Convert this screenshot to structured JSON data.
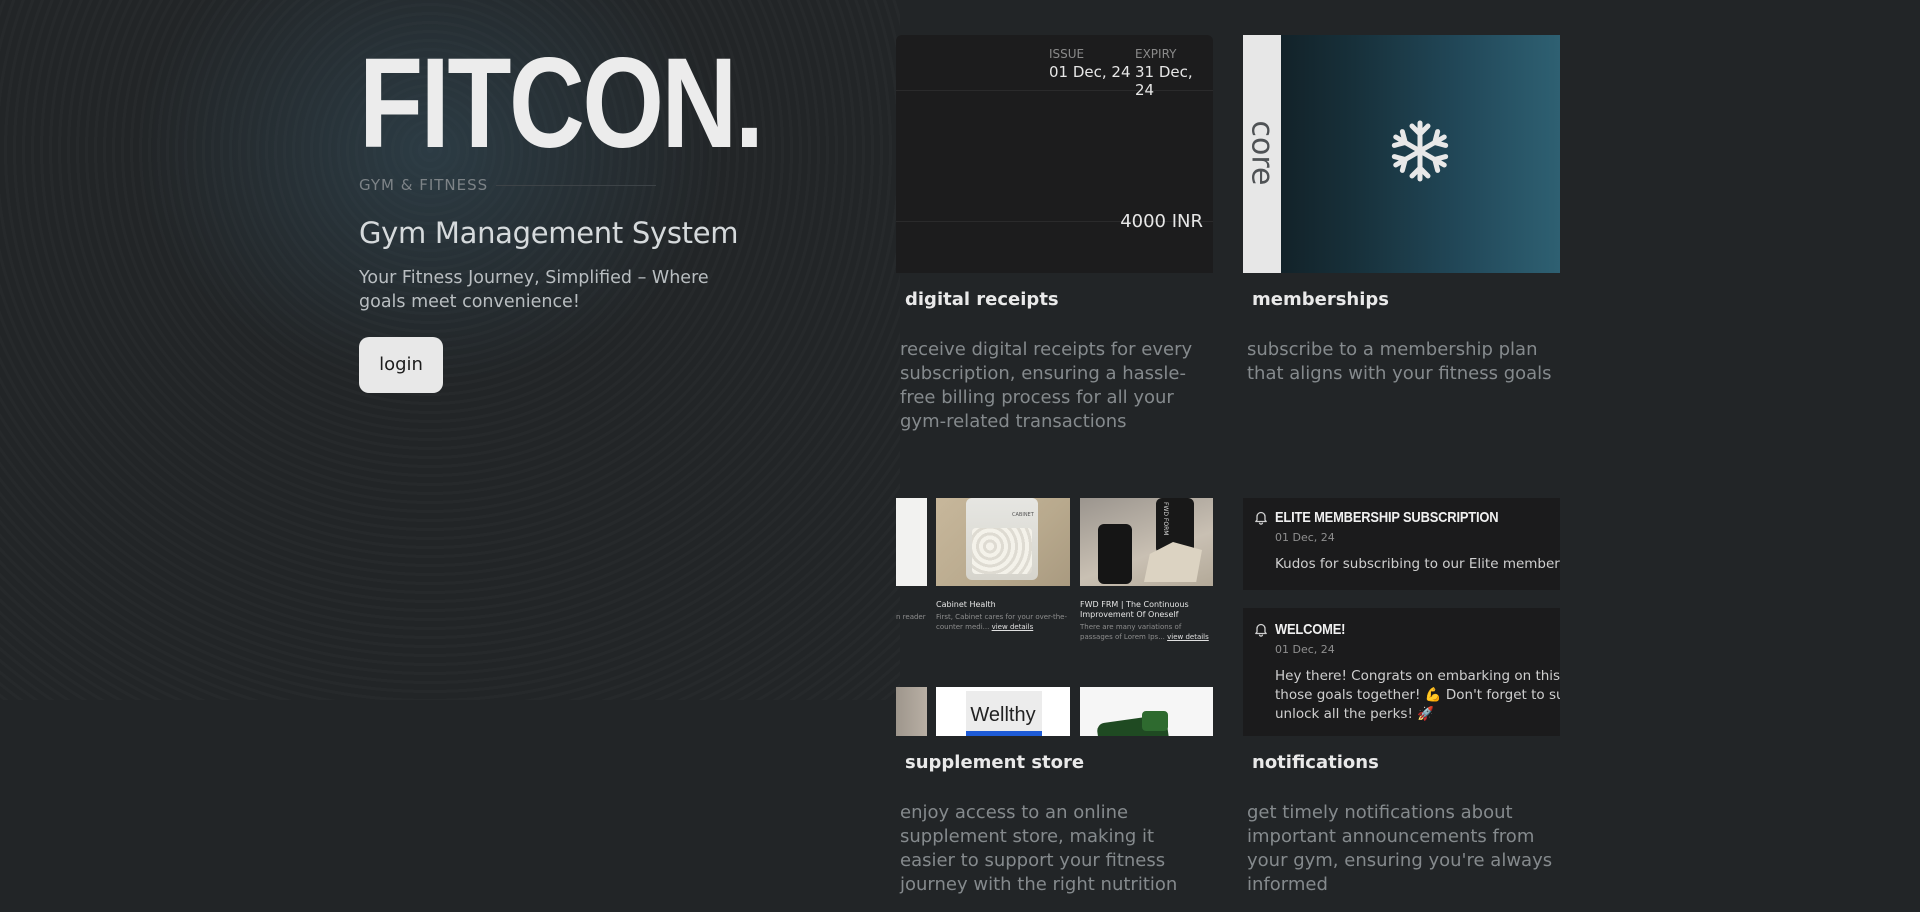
{
  "hero": {
    "logo": "FITCON.",
    "tagline": "GYM & FITNESS",
    "title": "Gym Management System",
    "subtitle": "Your Fitness Journey, Simplified – Where goals meet convenience!",
    "login_label": "login"
  },
  "features": {
    "receipts": {
      "title": "digital receipts",
      "description": "receive digital receipts for every subscription, ensuring a hassle-free billing process for all your gym-related transactions",
      "issue_label": "ISSUE",
      "issue_date": "01 Dec, 24",
      "expiry_label": "EXPIRY",
      "expiry_date": "31 Dec, 24",
      "amount": "4000 INR"
    },
    "memberships": {
      "title": "memberships",
      "description": "subscribe to a membership plan that aligns with your fitness goals",
      "plan_label": "core",
      "icon": "snowflake-icon"
    },
    "store": {
      "title": "supplement store",
      "description": "enjoy access to an online supplement store, making it easier to support your fitness journey with the right nutrition",
      "partial_text": "n reader",
      "products": [
        {
          "name": "Cabinet Health",
          "text": "First, Cabinet cares for your over-the-counter medi...",
          "link": "view details",
          "jar_label": "CABINET"
        },
        {
          "name": "FWD FRM | The Continuous Improvement Of Oneself",
          "text": "There are many variations of passages of Lorem Ips...",
          "link": "view details",
          "jar_label": "FWD FORM"
        }
      ],
      "bottom_row": [
        {
          "label": ""
        },
        {
          "label": "Wellthy"
        },
        {
          "label": ""
        }
      ]
    },
    "notifications": {
      "title": "notifications",
      "description": "get timely notifications about important announcements from your gym, ensuring you're always informed",
      "items": [
        {
          "title": "ELITE MEMBERSHIP SUBSCRIPTION",
          "date": "01 Dec, 24",
          "body": [
            "Kudos for subscribing to our Elite membership!"
          ]
        },
        {
          "title": "WELCOME!",
          "date": "01 Dec, 24",
          "body": [
            "Hey there! Congrats on embarking on this fitne",
            "those goals together! 💪 Don't forget to subsc",
            "unlock all the perks! 🚀"
          ]
        }
      ]
    }
  },
  "colors": {
    "background": "#222527",
    "card_dark": "#1c1c1d",
    "membership_teal": "#2e6072",
    "button_bg": "#e8e8e8"
  }
}
